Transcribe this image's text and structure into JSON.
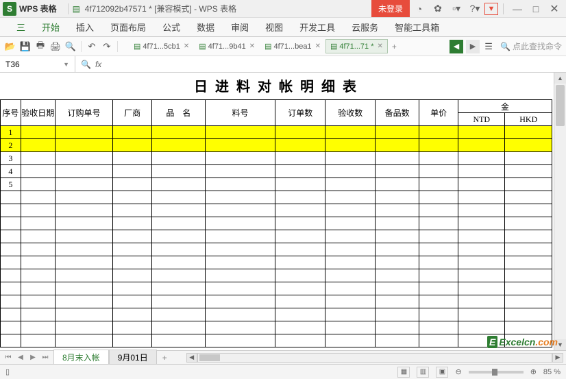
{
  "titlebar": {
    "app_name": "WPS 表格",
    "doc_title": "4f712092b47571 * [兼容模式] - WPS 表格",
    "login": "未登录"
  },
  "main_tabs": {
    "file": "三",
    "items": [
      "开始",
      "插入",
      "页面布局",
      "公式",
      "数据",
      "审阅",
      "视图",
      "开发工具",
      "云服务",
      "智能工具箱"
    ],
    "active": 0
  },
  "doc_tabs": {
    "items": [
      {
        "label": "4f71...5cb1",
        "active": false
      },
      {
        "label": "4f71...9b41",
        "active": false
      },
      {
        "label": "4f71...bea1",
        "active": false
      },
      {
        "label": "4f71...71 *",
        "active": true
      }
    ]
  },
  "search": {
    "placeholder": "点此查找命令"
  },
  "formula": {
    "name_box": "T36",
    "fx": "fx"
  },
  "sheet": {
    "title": "日 进 料 对 帐 明 细 表",
    "headers": {
      "seq": "序号",
      "date": "验收日期",
      "po": "订购单号",
      "vendor": "厂商",
      "product": "品　名",
      "part": "料号",
      "ord_qty": "订单数",
      "rcv_qty": "验收数",
      "spare_qty": "备品数",
      "price": "单价",
      "amount": "金",
      "ntd": "NTD",
      "hkd": "HKD"
    },
    "rows": [
      {
        "seq": "1",
        "yellow": true
      },
      {
        "seq": "2",
        "yellow": true
      },
      {
        "seq": "3",
        "yellow": false
      },
      {
        "seq": "4",
        "yellow": false
      },
      {
        "seq": "5",
        "yellow": false
      }
    ],
    "empty_row_count": 12
  },
  "sheet_tabs": {
    "items": [
      {
        "label": "8月末入帐",
        "active": true
      },
      {
        "label": "9月01日",
        "active": false
      }
    ]
  },
  "statusbar": {
    "zoom": "85 %"
  },
  "watermark": {
    "e": "E",
    "t1": "Excelcn",
    "t2": ".com"
  }
}
